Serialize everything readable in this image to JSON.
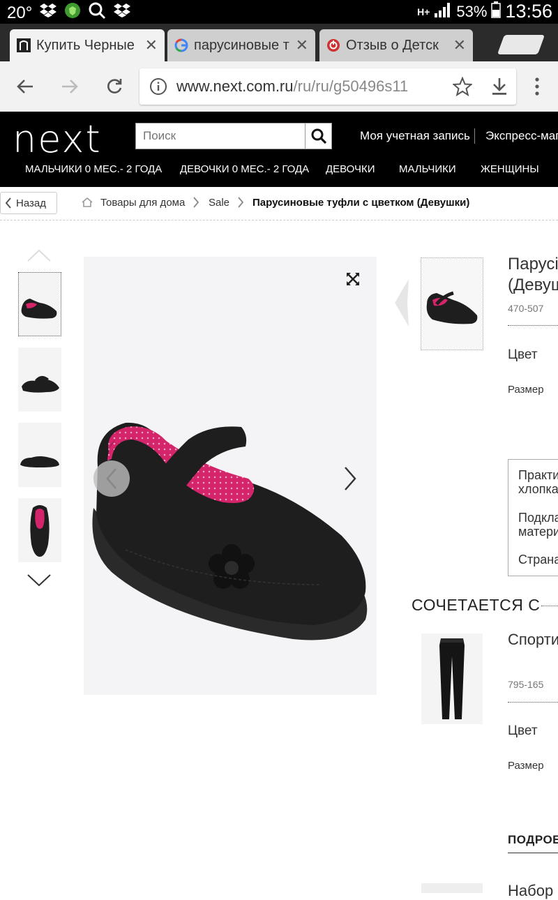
{
  "status_bar": {
    "temperature": "20°",
    "network": "H+",
    "battery": "53%",
    "time": "13:56"
  },
  "tabs": [
    {
      "title": "Купить Черные",
      "close": "✕",
      "active": true
    },
    {
      "title": "парусиновые т",
      "close": "✕",
      "active": false
    },
    {
      "title": "Отзыв о Детск",
      "close": "✕",
      "active": false
    }
  ],
  "address_bar": {
    "url_domain": "www.next.com.ru",
    "url_path": "/ru/ru/g50496s11"
  },
  "site_header": {
    "logo": "next",
    "search_placeholder": "Поиск",
    "account": "Моя учетная запись",
    "express": "Экспресс-маг",
    "nav": [
      "МАЛЬЧИКИ 0 МЕС.- 2 ГОДА",
      "ДЕВОЧКИ 0 МЕС.- 2 ГОДА",
      "ДЕВОЧКИ",
      "МАЛЬЧИКИ",
      "ЖЕНЩИНЫ"
    ]
  },
  "breadcrumb": {
    "back": "Назад",
    "items": [
      "Товары для дома",
      "Sale",
      "Парусиновые туфли с цветком (Девушки)"
    ]
  },
  "product": {
    "title_line1": "Парусі",
    "title_line2": "(Девуш",
    "code": "470-507",
    "color_label": "Цвет",
    "size_label": "Размер",
    "info_lines": [
      "Практи",
      "хлопка",
      "Подкла",
      "матери",
      "Страна"
    ]
  },
  "matches": {
    "heading": "СОЧЕТАЕТСЯ С",
    "item_title": "Спорти",
    "item_code": "795-165",
    "color_label": "Цвет",
    "size_label": "Размер"
  },
  "details_heading": "ПОДРОБ",
  "next_item_title": "Набор",
  "colors": {
    "header_bg": "#000000",
    "shoe_lining": "#d4246a",
    "shoe_body": "#1e1e1e"
  }
}
